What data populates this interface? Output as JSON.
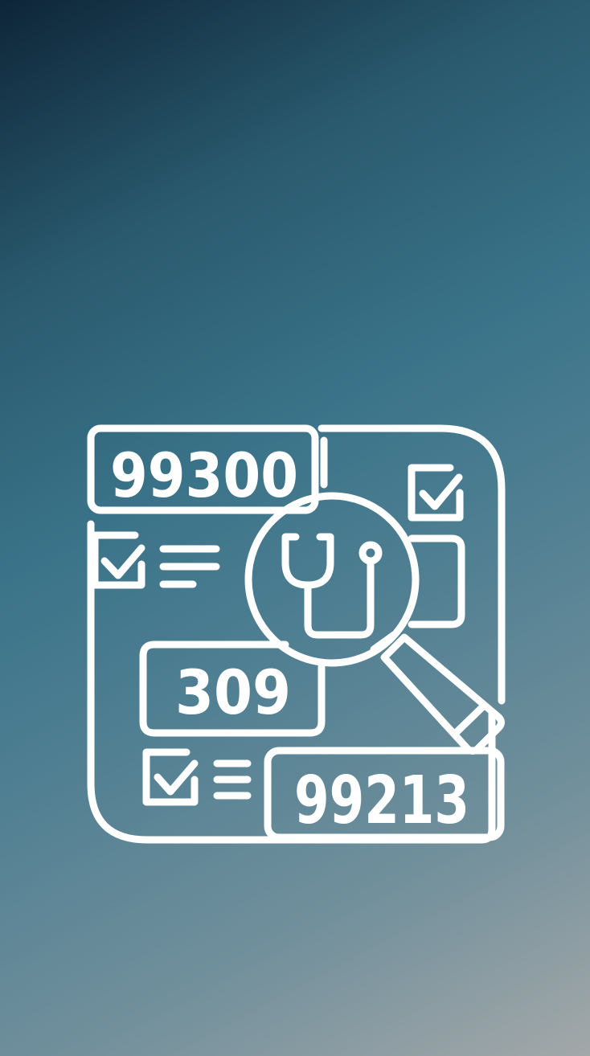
{
  "illustration": {
    "code_top": "99300",
    "code_middle": "309",
    "code_bottom": "99213",
    "icons": [
      "checkbox-icon",
      "text-lines-icon",
      "magnifier-icon",
      "stethoscope-icon"
    ],
    "colors": {
      "stroke": "#ffffff",
      "gradient_start": "#0e2538",
      "gradient_mid": "#3a7389",
      "gradient_end": "#a3a8a9"
    }
  }
}
